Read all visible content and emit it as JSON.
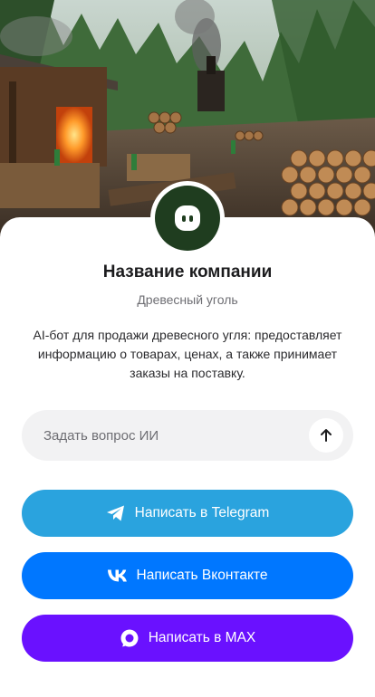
{
  "company": {
    "name": "Название компании",
    "category": "Древесный уголь",
    "description": "AI-бот для продажи древесного угля: предоставляет информацию о товарах, ценах, а также принимает заказы на поставку."
  },
  "ask": {
    "placeholder": "Задать вопрос ИИ"
  },
  "actions": {
    "telegram": {
      "label": "Написать в Telegram",
      "color": "#2AA3DE",
      "icon": "telegram-icon"
    },
    "vk": {
      "label": "Написать Вконтакте",
      "color": "#0077FF",
      "icon": "vk-icon"
    },
    "max": {
      "label": "Написать в MAX",
      "color": "#6A11FF",
      "icon": "max-icon"
    }
  },
  "avatar": {
    "icon": "chat-bot-icon",
    "color": "#1F3D1F"
  }
}
